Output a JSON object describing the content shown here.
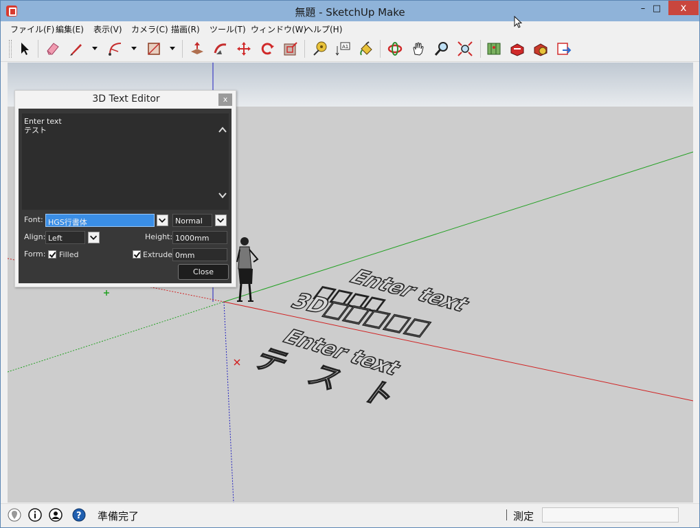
{
  "window": {
    "title": "無題 - SketchUp Make",
    "minimize": "–",
    "maximize": "□",
    "close": "x"
  },
  "menu": [
    "ファイル(F)",
    "編集(E)",
    "表示(V)",
    "カメラ(C)",
    "描画(R)",
    "ツール(T)",
    "ウィンドウ(W)",
    "ヘルプ(H)"
  ],
  "toolbar_icons": [
    "select-icon",
    "eraser-icon",
    "line-icon",
    "arc-icon",
    "rectangle-icon",
    "push-pull-icon",
    "follow-me-icon",
    "move-icon",
    "rotate-icon",
    "offset-icon",
    "tape-measure-icon",
    "text-icon",
    "paint-bucket-icon",
    "orbit-icon",
    "pan-icon",
    "zoom-icon",
    "zoom-extents-icon",
    "add-location-icon",
    "3d-warehouse-icon",
    "extension-warehouse-icon",
    "send-to-layout-icon"
  ],
  "dialog": {
    "title": "3D Text Editor",
    "close_x": "x",
    "text": "Enter text\nテスト",
    "font_label": "Font:",
    "font_value": "HGS行書体",
    "style_value": "Normal",
    "align_label": "Align:",
    "align_value": "Left",
    "height_label": "Height:",
    "height_value": "1000mm",
    "form_label": "Form:",
    "filled_label": "Filled",
    "filled_checked": true,
    "extrude_label": "Extrude:",
    "extrude_checked": true,
    "extrude_value": "0mm",
    "close_button": "Close"
  },
  "scene": {
    "text_objects": [
      "Enter text",
      "□□□□",
      "3D□□□□□",
      "Enter text",
      "テスト"
    ],
    "colors": {
      "axis_red": "#d02020",
      "axis_green": "#20a020",
      "axis_blue": "#2020c0",
      "sky": "#dde3ea",
      "ground": "#cdcdcd"
    }
  },
  "status": {
    "text": "準備完了",
    "measure_label": "測定",
    "measure_value": ""
  },
  "colors": {
    "titlebar": "#8fb3d9",
    "close_button": "#c9463d",
    "dialog_panel": "#383838",
    "font_select": "#3a8ee6"
  }
}
